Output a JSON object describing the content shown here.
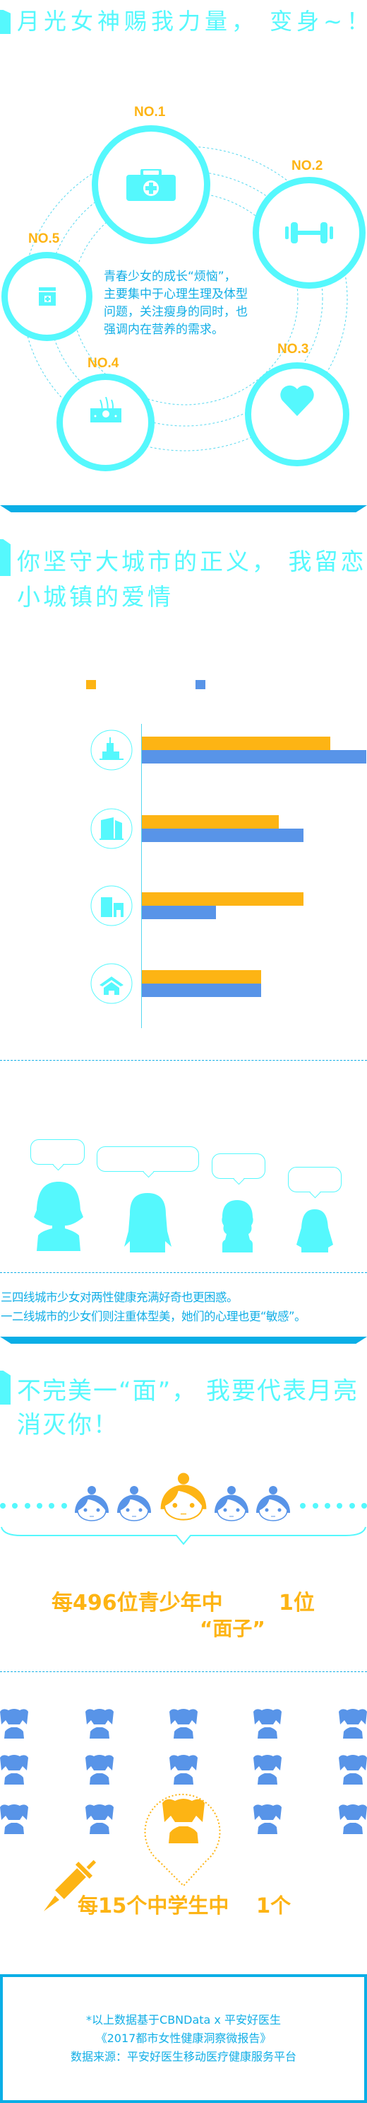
{
  "section1": {
    "title": "月光女神赐我力量， 变身~！",
    "items": [
      {
        "rank": "NO.1",
        "icon": "first-aid-kit-icon"
      },
      {
        "rank": "NO.2",
        "icon": "dumbbell-icon"
      },
      {
        "rank": "NO.3",
        "icon": "heart-icon"
      },
      {
        "rank": "NO.4",
        "icon": "skin-hair-icon"
      },
      {
        "rank": "NO.5",
        "icon": "medicine-box-icon"
      }
    ],
    "description": [
      "青春少女的成长“烦恼”，",
      "主要集中于心理生理及体型",
      "问题，关注瘦身的同时，也",
      "强调内在营养的需求。"
    ]
  },
  "section2": {
    "title_line1": "你坚守大城市的正义， 我留恋",
    "title_line2": "小城镇的爱情",
    "colors": {
      "series1": "#fdb414",
      "series2": "#5894e8"
    },
    "summary": [
      "三四线城市少女对两性健康充满好奇也更困惑。",
      "一二线城市的少女们则注重体型美，她们的心理也更“敏感”。"
    ]
  },
  "chart_data": {
    "type": "bar",
    "orientation": "horizontal",
    "categories": [
      "skyscraper-city-icon",
      "office-building-icon",
      "town-building-icon",
      "house-icon"
    ],
    "series": [
      {
        "name": "series1",
        "color": "#fdb414",
        "values": [
          84,
          61,
          72,
          53
        ]
      },
      {
        "name": "series2",
        "color": "#5894e8",
        "values": [
          100,
          72,
          33,
          53
        ]
      }
    ],
    "xlim": [
      0,
      100
    ],
    "grid": false
  },
  "section3": {
    "title_line1": "不完美一“面”， 我要代表月亮",
    "title_line2": "消灭你！",
    "stat1_main": "每496位青少年中",
    "stat1_count": "1位",
    "stat1_sub": "“面子”",
    "stat2_main": "每15个中学生中",
    "stat2_count": "1个",
    "highlight_color": "#fdb414",
    "base_color": "#5894e8"
  },
  "footer": {
    "line1": "*以上数据基于CBNData x 平安好医生",
    "line2": "《2017都市女性健康洞察微报告》",
    "line3": "数据来源：平安好医生移动医疗健康服务平台"
  }
}
